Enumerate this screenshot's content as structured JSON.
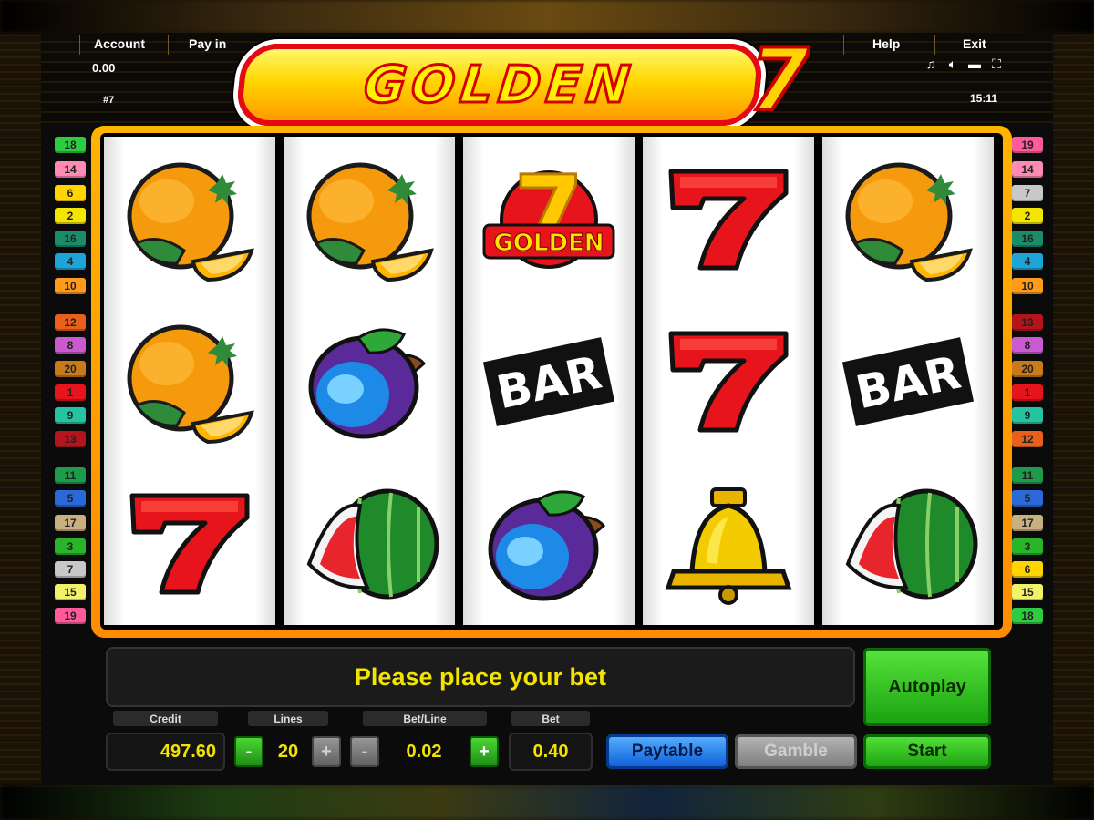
{
  "menu": {
    "account": "Account",
    "pay_in": "Pay in",
    "help": "Help",
    "exit": "Exit"
  },
  "status": {
    "balance": "0.00",
    "game_no": "#7",
    "time": "15:11"
  },
  "top_icons": [
    "music-icon",
    "speaker-icon",
    "screen-icon",
    "fullscreen-icon"
  ],
  "logo": {
    "word": "GOLDEN",
    "number": "7"
  },
  "reels": [
    [
      "orange",
      "orange",
      "seven"
    ],
    [
      "orange",
      "plum",
      "watermelon"
    ],
    [
      "golden7",
      "bar",
      "plum"
    ],
    [
      "seven",
      "seven",
      "bell"
    ],
    [
      "orange",
      "bar",
      "watermelon"
    ]
  ],
  "symbols": {
    "bar_text": "BAR",
    "golden7_text": "GOLDEN",
    "golden7_number": "7"
  },
  "paylines": {
    "left": [
      {
        "n": "18",
        "color": "#2ecc40"
      },
      {
        "n": "14",
        "color": "#ff8ab4"
      },
      {
        "n": "6",
        "color": "#ffd400"
      },
      {
        "n": "2",
        "color": "#f2e600"
      },
      {
        "n": "16",
        "color": "#1a8c6a"
      },
      {
        "n": "4",
        "color": "#1ea5d8"
      },
      {
        "n": "10",
        "color": "#ff9a1a"
      },
      {
        "n": "12",
        "color": "#e8601c"
      },
      {
        "n": "8",
        "color": "#c95ad0"
      },
      {
        "n": "20",
        "color": "#c97a1a"
      },
      {
        "n": "1",
        "color": "#e8141c"
      },
      {
        "n": "9",
        "color": "#25c4a0"
      },
      {
        "n": "13",
        "color": "#b4141c"
      },
      {
        "n": "11",
        "color": "#1e9a4a"
      },
      {
        "n": "5",
        "color": "#2a6ad8"
      },
      {
        "n": "17",
        "color": "#c8b080"
      },
      {
        "n": "3",
        "color": "#2ab42a"
      },
      {
        "n": "7",
        "color": "#c8c8c8"
      },
      {
        "n": "15",
        "color": "#f2f26a"
      },
      {
        "n": "19",
        "color": "#ff5a9a"
      }
    ],
    "right": [
      {
        "n": "19",
        "color": "#ff5a9a"
      },
      {
        "n": "14",
        "color": "#ff8ab4"
      },
      {
        "n": "7",
        "color": "#c8c8c8"
      },
      {
        "n": "2",
        "color": "#f2e600"
      },
      {
        "n": "16",
        "color": "#1a8c6a"
      },
      {
        "n": "4",
        "color": "#1ea5d8"
      },
      {
        "n": "10",
        "color": "#ff9a1a"
      },
      {
        "n": "13",
        "color": "#b4141c"
      },
      {
        "n": "8",
        "color": "#c95ad0"
      },
      {
        "n": "20",
        "color": "#c97a1a"
      },
      {
        "n": "1",
        "color": "#e8141c"
      },
      {
        "n": "9",
        "color": "#25c4a0"
      },
      {
        "n": "12",
        "color": "#e8601c"
      },
      {
        "n": "11",
        "color": "#1e9a4a"
      },
      {
        "n": "5",
        "color": "#2a6ad8"
      },
      {
        "n": "17",
        "color": "#c8b080"
      },
      {
        "n": "3",
        "color": "#2ab42a"
      },
      {
        "n": "6",
        "color": "#ffd400"
      },
      {
        "n": "15",
        "color": "#f2f26a"
      },
      {
        "n": "18",
        "color": "#2ecc40"
      }
    ]
  },
  "message": "Please place your bet",
  "controls": {
    "credit_label": "Credit",
    "credit": "497.60",
    "lines_label": "Lines",
    "lines": "20",
    "betline_label": "Bet/Line",
    "betline": "0.02",
    "bet_label": "Bet",
    "bet": "0.40",
    "minus": "-",
    "plus": "+"
  },
  "buttons": {
    "autoplay": "Autoplay",
    "paytable": "Paytable",
    "gamble": "Gamble",
    "start": "Start"
  }
}
